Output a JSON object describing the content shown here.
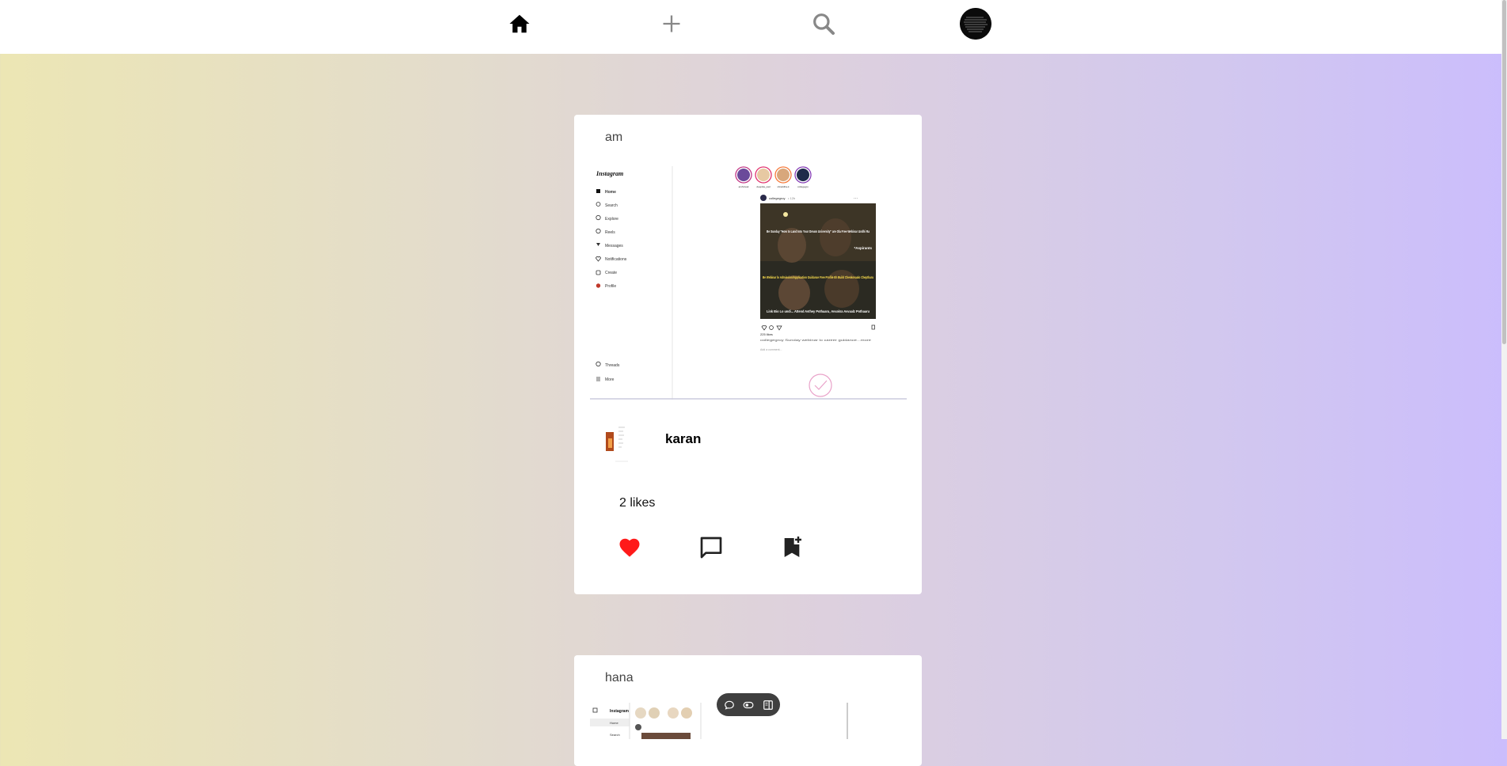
{
  "nav": {
    "home_icon": "home-icon",
    "add_icon": "plus-icon",
    "search_icon": "search-icon",
    "profile_icon": "avatar"
  },
  "posts": [
    {
      "author": "am",
      "username": "karan",
      "likes": "2 likes",
      "liked": true,
      "screenshot": {
        "logo": "Instagram",
        "menu": [
          "Home",
          "Search",
          "Explore",
          "Reels",
          "Messages",
          "Notifications",
          "Create",
          "Profile"
        ],
        "bottom_menu": [
          "Threads",
          "More"
        ],
        "story_names": [
          "arshvivak",
          "deepika_pad",
          "shraddha-k",
          "collegegro"
        ],
        "post_handle": "collegegroy",
        "post_meta": "• 12h",
        "meme_lines": [
          "Be Sunday \"How to Land Into Your Dream University\" are Ola Free Webinar Undhi Ra",
          "*Aspirants",
          "Be Webinar lo Admission/Application Guidance Free Profile Eh Build Cheskovaalo Cheptharu",
          "Link Bio Lo undi... Attend Avthey Pothaaru, Avvakra Avvaalz Pothaaru"
        ],
        "likes_small": "225 likes",
        "caption_small": "collegegroy Sunday webinar lo career guidance...more",
        "comment_placeholder": "Add a comment..."
      }
    },
    {
      "author": "hana",
      "screenshot": {
        "logo": "Instagram",
        "menu": [
          "Home",
          "Search"
        ]
      }
    }
  ],
  "colors": {
    "like": "#ff1a1a",
    "icon": "#222222"
  }
}
